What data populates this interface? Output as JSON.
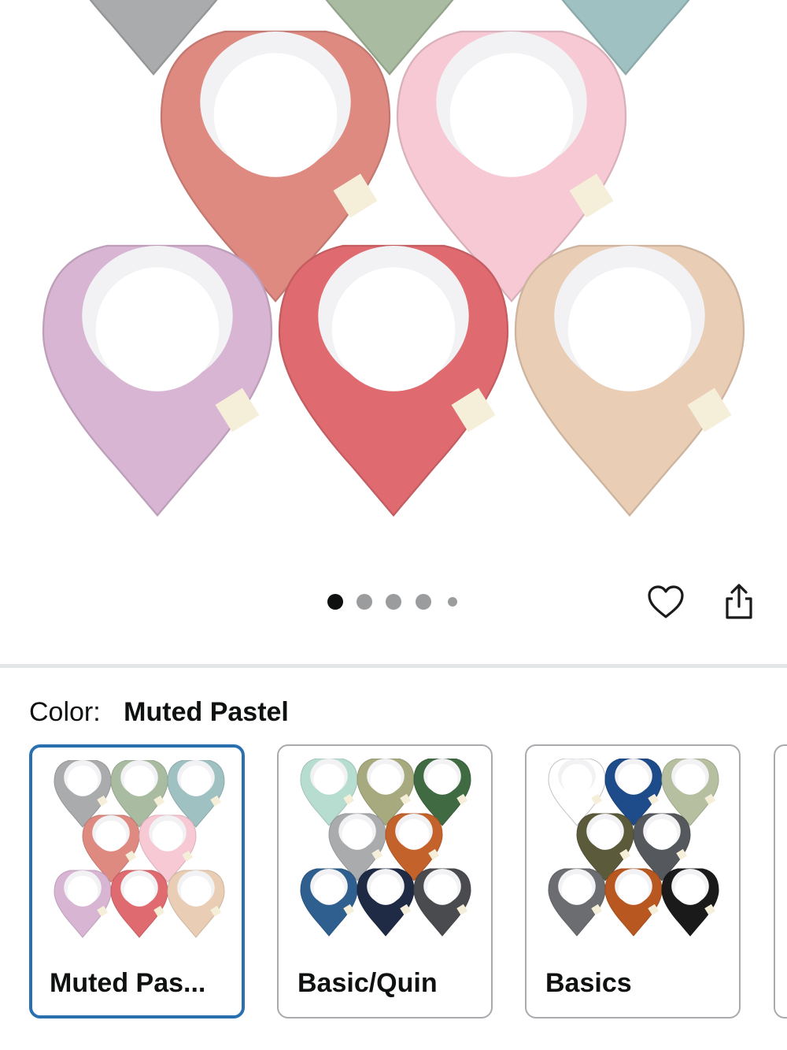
{
  "gallery": {
    "image_alt": "Muted Pastel bandana bibs",
    "bib_colors": [
      "#a9abac",
      "#a9bba0",
      "#9fc1c1",
      "#de8a80",
      "#f7c9d4",
      "#d8b5d3",
      "#df6a6f",
      "#e9cdb5"
    ],
    "pager": {
      "count": 5,
      "active": 0
    },
    "favorite_icon": "heart-outline-icon",
    "share_icon": "share-icon"
  },
  "color_selector": {
    "label": "Color:",
    "selected_value": "Muted Pastel",
    "options": [
      {
        "name": "Muted Pas...",
        "colors": [
          "#a9abac",
          "#a9bba0",
          "#9fc1c1",
          "#de8a80",
          "#f7c9d4",
          "#d8b5d3",
          "#df6a6f",
          "#e9cdb5"
        ],
        "selected": true
      },
      {
        "name": "Basic/Quin",
        "colors": [
          "#b7ddd0",
          "#a7a97e",
          "#3f6a42",
          "#a9abac",
          "#c4622b",
          "#2f5f8f",
          "#1f2a44",
          "#4a4b4e"
        ],
        "selected": false
      },
      {
        "name": "Basics",
        "colors": [
          "#ffffff",
          "#1e4b8a",
          "#b6bf9f",
          "#5b5a3b",
          "#55585c",
          "#6b6d70",
          "#b8571f",
          "#1a1a1a"
        ],
        "selected": false
      }
    ]
  }
}
